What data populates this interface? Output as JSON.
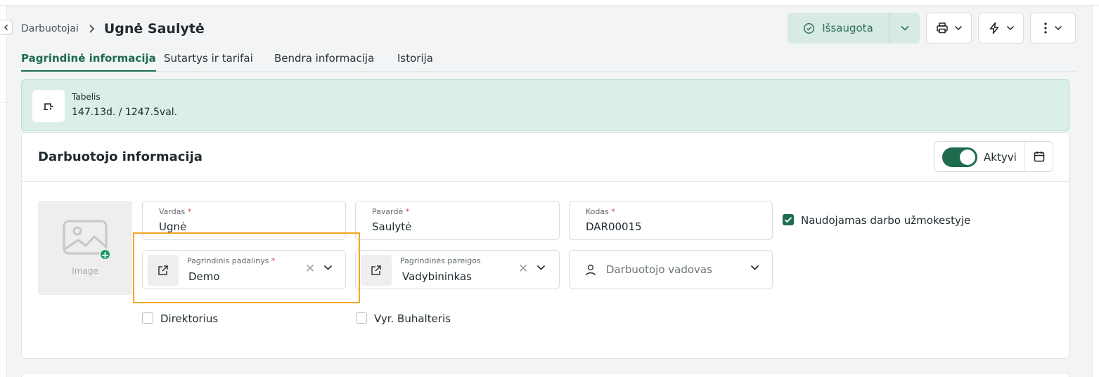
{
  "breadcrumb": {
    "parent": "Darbuotojai",
    "current": "Ugnė Saulytė"
  },
  "toolbar": {
    "save_label": "Išsaugota",
    "icons": [
      "check-circle-icon",
      "chevron-down-icon",
      "printer-icon",
      "lightning-icon",
      "more-vertical-icon"
    ]
  },
  "tabs": [
    {
      "label": "Pagrindinė informacija",
      "active": true
    },
    {
      "label": "Sutartys ir tarifai",
      "active": false
    },
    {
      "label": "Bendra informacija",
      "active": false
    },
    {
      "label": "Istorija",
      "active": false
    }
  ],
  "banner": {
    "title": "Tabelis",
    "value": "147.13d. / 1247.5val."
  },
  "card": {
    "title": "Darbuotojo informacija",
    "active_label": "Aktyvi",
    "active": true
  },
  "photo": {
    "label": "Image"
  },
  "fields": {
    "first_name": {
      "label": "Vardas",
      "required": "*",
      "value": "Ugnė"
    },
    "last_name": {
      "label": "Pavardė",
      "required": "*",
      "value": "Saulytė"
    },
    "code": {
      "label": "Kodas",
      "required": "*",
      "value": "DAR00015"
    },
    "department": {
      "label": "Pagrindinis padalinys",
      "required": "*",
      "value": "Demo"
    },
    "position": {
      "label": "Pagrindinės pareigos",
      "value": "Vadybininkas"
    },
    "manager": {
      "placeholder": "Darbuotojo vadovas"
    }
  },
  "checkboxes": {
    "payroll": {
      "label": "Naudojamas darbo užmokestyje",
      "checked": true
    },
    "director": {
      "label": "Direktorius",
      "checked": false
    },
    "accountant": {
      "label": "Vyr. Buhalteris",
      "checked": false
    }
  },
  "colors": {
    "accent": "#1e6b4e",
    "banner_bg": "#d9efe7",
    "highlight": "#f5a623",
    "required": "#e0474c"
  }
}
